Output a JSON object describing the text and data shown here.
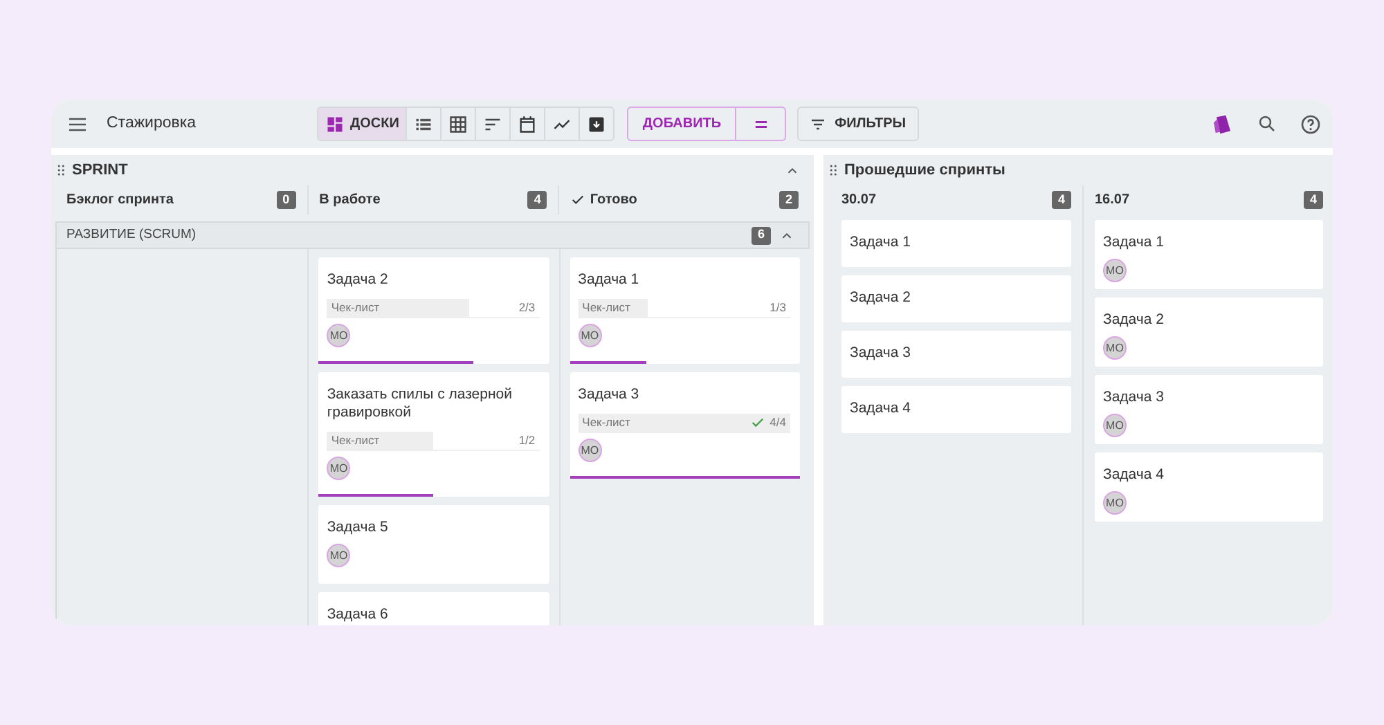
{
  "toolbar": {
    "title": "Стажировка",
    "view_tabs": [
      {
        "kind": "boards",
        "label": "ДОСКИ",
        "selected": true
      },
      {
        "kind": "list",
        "selected": false
      },
      {
        "kind": "table",
        "selected": false
      },
      {
        "kind": "sort",
        "selected": false
      },
      {
        "kind": "calendar",
        "selected": false
      },
      {
        "kind": "chart",
        "selected": false
      },
      {
        "kind": "archive",
        "selected": false
      }
    ],
    "add_button": "ДОБАВИТЬ",
    "filters_button": "ФИЛЬТРЫ"
  },
  "sprint": {
    "title": "SPRINT",
    "columns": [
      {
        "title": "Бэклог спринта",
        "count": "0",
        "done": false
      },
      {
        "title": "В работе",
        "count": "4",
        "done": false,
        "cards": [
          {
            "title": "Задача 2",
            "checklist": {
              "label": "Чек-лист",
              "reading": "2/3",
              "level": 0.67,
              "complete": false
            },
            "assignee": "МО"
          },
          {
            "title": "Заказать спилы с лазерной гравировкой",
            "checklist": {
              "label": "Чек-лист",
              "reading": "1/2",
              "level": 0.5,
              "complete": false
            },
            "assignee": "МО"
          },
          {
            "title": "Задача 5",
            "assignee": "МО"
          },
          {
            "title": "Задача 6"
          }
        ]
      },
      {
        "title": "Готово",
        "count": "2",
        "done": true,
        "cards": [
          {
            "title": "Задача 1",
            "checklist": {
              "label": "Чек-лист",
              "reading": "1/3",
              "level": 0.33,
              "complete": false
            },
            "assignee": "МО"
          },
          {
            "title": "Задача 3",
            "checklist": {
              "label": "Чек-лист",
              "reading": "4/4",
              "level": 1,
              "complete": true
            },
            "assignee": "МО"
          }
        ]
      }
    ],
    "swimlane": {
      "title": "РАЗВИТИЕ (SCRUM)",
      "count": "6"
    }
  },
  "past_sprints": {
    "title": "Прошедшие спринты",
    "columns": [
      {
        "title": "30.07",
        "count": "4",
        "cards": [
          {
            "title": "Задача 1"
          },
          {
            "title": "Задача 2"
          },
          {
            "title": "Задача 3"
          },
          {
            "title": "Задача 4"
          }
        ]
      },
      {
        "title": "16.07",
        "count": "4",
        "cards": [
          {
            "title": "Задача 1",
            "assignee": "МО"
          },
          {
            "title": "Задача 2",
            "assignee": "МО"
          },
          {
            "title": "Задача 3",
            "assignee": "МО"
          },
          {
            "title": "Задача 4",
            "assignee": "МО"
          }
        ]
      }
    ]
  }
}
